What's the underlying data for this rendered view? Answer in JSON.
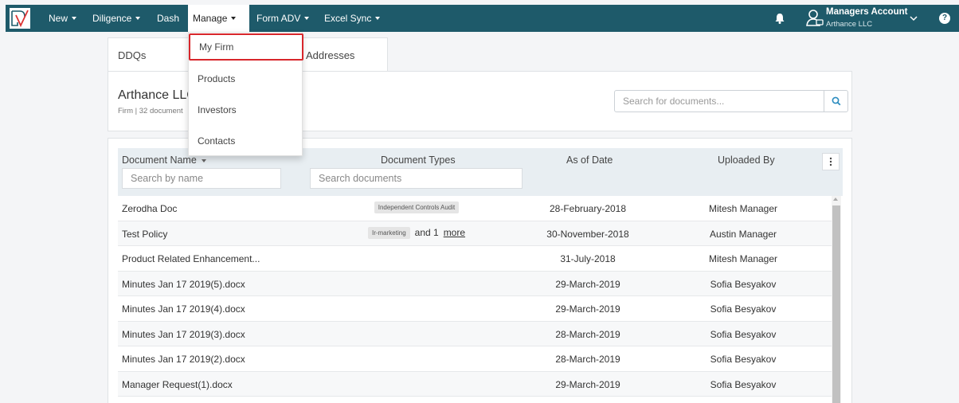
{
  "nav": {
    "items": [
      {
        "label": "New",
        "active": false
      },
      {
        "label": "Diligence",
        "active": false
      },
      {
        "label": "Dash",
        "active": false
      },
      {
        "label": "Manage",
        "active": true
      },
      {
        "label": "Form ADV",
        "active": false
      },
      {
        "label": "Excel Sync",
        "active": false
      }
    ],
    "account_name": "Managers Account",
    "account_org": "Arthance LLC",
    "help_label": "?"
  },
  "dropdown": {
    "items": [
      "My Firm",
      "Products",
      "Investors",
      "Contacts"
    ],
    "highlighted_index": 0
  },
  "tabs": [
    "DDQs",
    "Addresses"
  ],
  "firm": {
    "name": "Arthance LLC",
    "meta": "Firm | 32 document"
  },
  "search": {
    "placeholder": "Search for documents..."
  },
  "table": {
    "columns": [
      "Document Name",
      "Document Types",
      "As of Date",
      "Uploaded By"
    ],
    "filters": {
      "name_placeholder": "Search by name",
      "types_placeholder": "Search documents"
    },
    "rows": [
      {
        "name": "Zerodha Doc",
        "types": [
          "Independent Controls Audit"
        ],
        "more": "",
        "date": "28-February-2018",
        "uploaded_by": "Mitesh Manager"
      },
      {
        "name": "Test Policy",
        "types": [
          "Ir-marketing"
        ],
        "more_prefix": "and 1",
        "more": "more",
        "date": "30-November-2018",
        "uploaded_by": "Austin Manager"
      },
      {
        "name": "Product Related Enhancement...",
        "types": [],
        "more": "",
        "date": "31-July-2018",
        "uploaded_by": "Mitesh Manager"
      },
      {
        "name": "Minutes Jan 17 2019(5).docx",
        "types": [],
        "more": "",
        "date": "29-March-2019",
        "uploaded_by": "Sofia Besyakov"
      },
      {
        "name": "Minutes Jan 17 2019(4).docx",
        "types": [],
        "more": "",
        "date": "29-March-2019",
        "uploaded_by": "Sofia Besyakov"
      },
      {
        "name": "Minutes Jan 17 2019(3).docx",
        "types": [],
        "more": "",
        "date": "28-March-2019",
        "uploaded_by": "Sofia Besyakov"
      },
      {
        "name": "Minutes Jan 17 2019(2).docx",
        "types": [],
        "more": "",
        "date": "28-March-2019",
        "uploaded_by": "Sofia Besyakov"
      },
      {
        "name": "Manager Request(1).docx",
        "types": [],
        "more": "",
        "date": "29-March-2019",
        "uploaded_by": "Sofia Besyakov"
      }
    ]
  },
  "colors": {
    "navbar": "#1e5a6a",
    "highlight_border": "#d8262b",
    "search_icon": "#2b8cbf"
  }
}
